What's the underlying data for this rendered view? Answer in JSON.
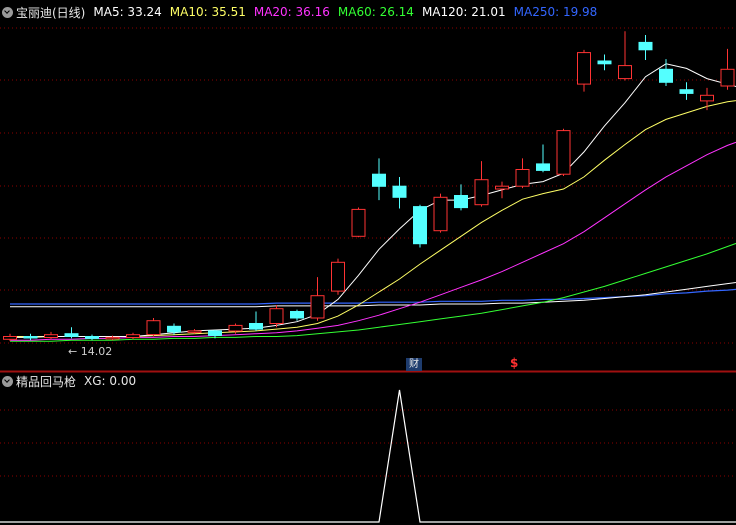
{
  "header": {
    "stock_name": "宝丽迪(日线)",
    "ma_labels": [
      {
        "text": "MA5: 33.24",
        "color": "#ffffff"
      },
      {
        "text": "MA10: 35.51",
        "color": "#ffff66"
      },
      {
        "text": "MA20: 36.16",
        "color": "#ff33ff"
      },
      {
        "text": "MA60: 26.14",
        "color": "#33ff33"
      },
      {
        "text": "MA120: 21.01",
        "color": "#ffffff"
      },
      {
        "text": "MA250: 19.98",
        "color": "#3366ff"
      }
    ]
  },
  "sub_panel": {
    "indicator_name": "精品回马枪",
    "value_text": "XG: 0.00"
  },
  "markers": {
    "low_label": "← 14.02",
    "finance_badge": "财",
    "dividend_mark": "$"
  },
  "colors": {
    "up": "#ff3333",
    "down": "#54ffff",
    "grid": "#8b0000",
    "ma5": "#ffffff",
    "ma10": "#ffff66",
    "ma20": "#ff33ff",
    "ma60": "#33ff33",
    "ma120": "#ffffff",
    "ma250": "#3366ff",
    "signal": "#ffffff"
  },
  "chart_data": {
    "type": "candlestick",
    "price_range": [
      12.5,
      48.5
    ],
    "candles": [
      {
        "o": 14.3,
        "c": 14.6,
        "h": 14.9,
        "l": 14.1
      },
      {
        "o": 14.6,
        "c": 14.5,
        "h": 14.9,
        "l": 14.2
      },
      {
        "o": 14.5,
        "c": 14.8,
        "h": 15.1,
        "l": 14.3
      },
      {
        "o": 14.9,
        "c": 14.6,
        "h": 15.6,
        "l": 14.4
      },
      {
        "o": 14.6,
        "c": 14.4,
        "h": 14.8,
        "l": 14.2
      },
      {
        "o": 14.4,
        "c": 14.5,
        "h": 14.7,
        "l": 14.2
      },
      {
        "o": 14.5,
        "c": 14.8,
        "h": 15.0,
        "l": 14.3
      },
      {
        "o": 14.8,
        "c": 16.3,
        "h": 16.6,
        "l": 14.6
      },
      {
        "o": 15.7,
        "c": 15.1,
        "h": 16.0,
        "l": 14.8
      },
      {
        "o": 15.1,
        "c": 15.2,
        "h": 15.4,
        "l": 14.9
      },
      {
        "o": 15.2,
        "c": 14.7,
        "h": 15.3,
        "l": 14.4
      },
      {
        "o": 15.2,
        "c": 15.8,
        "h": 16.0,
        "l": 14.9
      },
      {
        "o": 16.0,
        "c": 15.4,
        "h": 17.3,
        "l": 15.2
      },
      {
        "o": 16.0,
        "c": 17.6,
        "h": 18.0,
        "l": 15.6
      },
      {
        "o": 17.3,
        "c": 16.6,
        "h": 17.5,
        "l": 16.3
      },
      {
        "o": 16.6,
        "c": 19.0,
        "h": 21.0,
        "l": 16.3
      },
      {
        "o": 19.5,
        "c": 22.6,
        "h": 23.0,
        "l": 19.1
      },
      {
        "o": 25.4,
        "c": 28.3,
        "h": 28.5,
        "l": 25.3
      },
      {
        "o": 32.1,
        "c": 30.8,
        "h": 33.8,
        "l": 29.3
      },
      {
        "o": 30.8,
        "c": 29.6,
        "h": 31.8,
        "l": 28.4
      },
      {
        "o": 28.6,
        "c": 24.6,
        "h": 28.8,
        "l": 24.2
      },
      {
        "o": 26.0,
        "c": 29.6,
        "h": 30.0,
        "l": 25.8
      },
      {
        "o": 29.8,
        "c": 28.5,
        "h": 31.0,
        "l": 28.2
      },
      {
        "o": 28.8,
        "c": 31.5,
        "h": 33.5,
        "l": 28.6
      },
      {
        "o": 30.5,
        "c": 30.8,
        "h": 31.3,
        "l": 29.5
      },
      {
        "o": 30.8,
        "c": 32.6,
        "h": 33.8,
        "l": 30.6
      },
      {
        "o": 33.2,
        "c": 32.5,
        "h": 35.3,
        "l": 32.3
      },
      {
        "o": 32.1,
        "c": 36.8,
        "h": 37.0,
        "l": 31.9
      },
      {
        "o": 41.8,
        "c": 45.2,
        "h": 45.5,
        "l": 41.0
      },
      {
        "o": 44.3,
        "c": 44.0,
        "h": 45.0,
        "l": 43.3
      },
      {
        "o": 42.4,
        "c": 43.8,
        "h": 47.5,
        "l": 42.2
      },
      {
        "o": 46.3,
        "c": 45.5,
        "h": 47.1,
        "l": 44.4
      },
      {
        "o": 43.4,
        "c": 42.0,
        "h": 44.5,
        "l": 41.6
      },
      {
        "o": 41.2,
        "c": 40.8,
        "h": 42.0,
        "l": 40.1
      },
      {
        "o": 40.0,
        "c": 40.6,
        "h": 41.4,
        "l": 39.0
      },
      {
        "o": 41.6,
        "c": 43.4,
        "h": 45.6,
        "l": 41.2
      },
      {
        "o": 43.0,
        "c": 40.3,
        "h": 43.3,
        "l": 39.6
      },
      {
        "o": 40.2,
        "c": 41.0,
        "h": 41.5,
        "l": 39.6
      }
    ],
    "ma5": [
      14.5,
      14.5,
      14.6,
      14.6,
      14.6,
      14.6,
      14.6,
      14.8,
      15.0,
      15.2,
      15.3,
      15.4,
      15.5,
      15.8,
      16.2,
      17.0,
      18.6,
      21.2,
      24.0,
      26.2,
      28.2,
      29.3,
      29.3,
      29.8,
      30.4,
      31.0,
      31.3,
      32.2,
      34.5,
      37.3,
      39.8,
      42.6,
      44.0,
      43.5,
      42.4,
      41.8,
      41.2,
      41.0
    ],
    "ma10": [
      14.6,
      14.6,
      14.6,
      14.6,
      14.6,
      14.6,
      14.6,
      14.7,
      14.8,
      14.9,
      15.0,
      15.1,
      15.2,
      15.4,
      15.6,
      16.0,
      16.8,
      18.0,
      19.4,
      20.8,
      22.4,
      23.9,
      25.4,
      26.9,
      28.2,
      29.4,
      30.0,
      30.5,
      31.8,
      33.6,
      35.3,
      36.9,
      38.0,
      38.7,
      39.4,
      39.9,
      40.2,
      40.4
    ],
    "ma20": [
      14.2,
      14.2,
      14.3,
      14.3,
      14.4,
      14.4,
      14.5,
      14.5,
      14.6,
      14.6,
      14.7,
      14.8,
      14.9,
      15.0,
      15.2,
      15.5,
      15.8,
      16.3,
      16.9,
      17.6,
      18.3,
      19.1,
      19.9,
      20.7,
      21.6,
      22.6,
      23.6,
      24.6,
      25.9,
      27.4,
      28.9,
      30.4,
      31.8,
      33.0,
      34.2,
      35.2,
      36.0,
      36.5
    ],
    "ma60": [
      14.1,
      14.1,
      14.1,
      14.2,
      14.2,
      14.2,
      14.3,
      14.3,
      14.4,
      14.4,
      14.5,
      14.5,
      14.6,
      14.6,
      14.7,
      14.9,
      15.1,
      15.3,
      15.6,
      15.9,
      16.2,
      16.5,
      16.8,
      17.1,
      17.5,
      17.9,
      18.3,
      18.8,
      19.4,
      20.0,
      20.7,
      21.4,
      22.1,
      22.8,
      23.5,
      24.3,
      25.1,
      25.9
    ],
    "ma120": [
      17.8,
      17.8,
      17.8,
      17.8,
      17.8,
      17.8,
      17.8,
      17.8,
      17.8,
      17.8,
      17.8,
      17.8,
      17.8,
      17.9,
      17.9,
      17.9,
      17.9,
      17.9,
      18.0,
      18.0,
      18.0,
      18.1,
      18.1,
      18.1,
      18.2,
      18.2,
      18.3,
      18.4,
      18.5,
      18.7,
      18.9,
      19.1,
      19.4,
      19.7,
      20.0,
      20.3,
      20.6,
      21.0
    ],
    "ma250": [
      18.1,
      18.1,
      18.1,
      18.1,
      18.1,
      18.1,
      18.1,
      18.1,
      18.1,
      18.1,
      18.1,
      18.1,
      18.1,
      18.2,
      18.2,
      18.2,
      18.2,
      18.2,
      18.3,
      18.3,
      18.3,
      18.4,
      18.4,
      18.4,
      18.5,
      18.5,
      18.6,
      18.6,
      18.7,
      18.8,
      18.9,
      19.0,
      19.2,
      19.3,
      19.5,
      19.6,
      19.8,
      19.98
    ],
    "xg_signal_range": [
      0,
      1
    ],
    "xg_signal": [
      0,
      0,
      0,
      0,
      0,
      0,
      0,
      0,
      0,
      0,
      0,
      0,
      0,
      0,
      0,
      0,
      0,
      0,
      0,
      1,
      0,
      0,
      0,
      0,
      0,
      0,
      0,
      0,
      0,
      0,
      0,
      0,
      0,
      0,
      0,
      0,
      0,
      0
    ]
  }
}
